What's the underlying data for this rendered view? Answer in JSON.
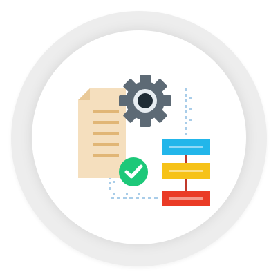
{
  "illustration": {
    "description_icons": [
      "document-icon",
      "gear-icon",
      "checkmark-icon",
      "flowchart-icon"
    ],
    "colors": {
      "ring": "#ededed",
      "disc": "#ffffff",
      "document": "#f5dfbe",
      "document_lines": "#e1b676",
      "gear": "#5d6a75",
      "gear_center": "#1f2c35",
      "check_circle": "#1dc879",
      "flow_top": "#22b6ea",
      "flow_middle": "#f6c218",
      "flow_bottom": "#ea3b26",
      "flow_line": "#c0392b",
      "dots": "#9fc7e8"
    }
  }
}
